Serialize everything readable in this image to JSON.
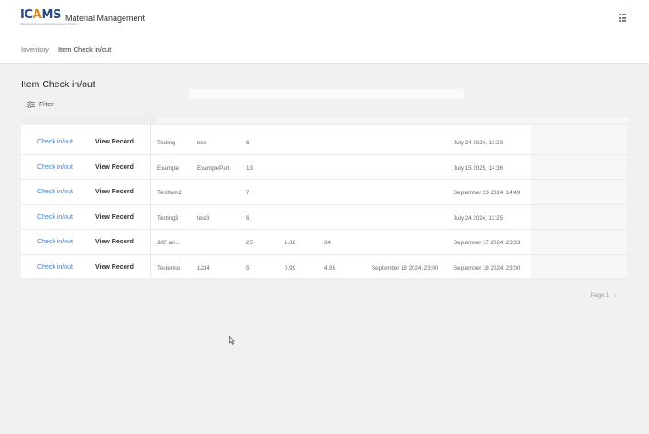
{
  "header": {
    "logo_text_main": "IC",
    "logo_text_accent": "A",
    "logo_text_end": "MS",
    "logo_subtitle": "Integrated Campus Asset Management System",
    "app_title": "Material Management",
    "apps_icon": "grid-icon"
  },
  "breadcrumb": {
    "items": [
      "Inventory",
      "Item Check in/out"
    ]
  },
  "page": {
    "title": "Item Check in/out",
    "filter_label": "Filter",
    "filter_icon": "sliders-icon"
  },
  "table": {
    "rows": [
      {
        "action": "Check in/out",
        "record": "View Record",
        "c1": "Testing",
        "c2": "test",
        "c3": "6",
        "c4": "",
        "c5": "",
        "c6": "",
        "c7": "July 24 2024, 13:23"
      },
      {
        "action": "Check in/out",
        "record": "View Record",
        "c1": "Example",
        "c2": "ExamplePart",
        "c3": "13",
        "c4": "",
        "c5": "",
        "c6": "",
        "c7": "July 15 2025, 14:36"
      },
      {
        "action": "Check in/out",
        "record": "View Record",
        "c1": "TestItem2",
        "c2": "",
        "c3": "7",
        "c4": "",
        "c5": "",
        "c6": "",
        "c7": "September 23 2024, 14:49"
      },
      {
        "action": "Check in/out",
        "record": "View Record",
        "c1": "Testing3",
        "c2": "test3",
        "c3": "6",
        "c4": "",
        "c5": "",
        "c6": "",
        "c7": "July 24 2024, 13:25"
      },
      {
        "action": "Check in/out",
        "record": "View Record",
        "c1": "3/8\" air...",
        "c2": "",
        "c3": "25",
        "c4": "1.36",
        "c5": "34",
        "c6": "",
        "c7": "September 17 2024, 23:33"
      },
      {
        "action": "Check in/out",
        "record": "View Record",
        "c1": "Testerino",
        "c2": "1234",
        "c3": "5",
        "c4": "0.99",
        "c5": "4.95",
        "c6": "September 18 2024, 23:00",
        "c7": "September 18 2024, 23:00"
      }
    ]
  },
  "pager": {
    "prev_icon": "chevron-left-icon",
    "label": "Page 1",
    "next_icon": "chevron-right-icon"
  }
}
